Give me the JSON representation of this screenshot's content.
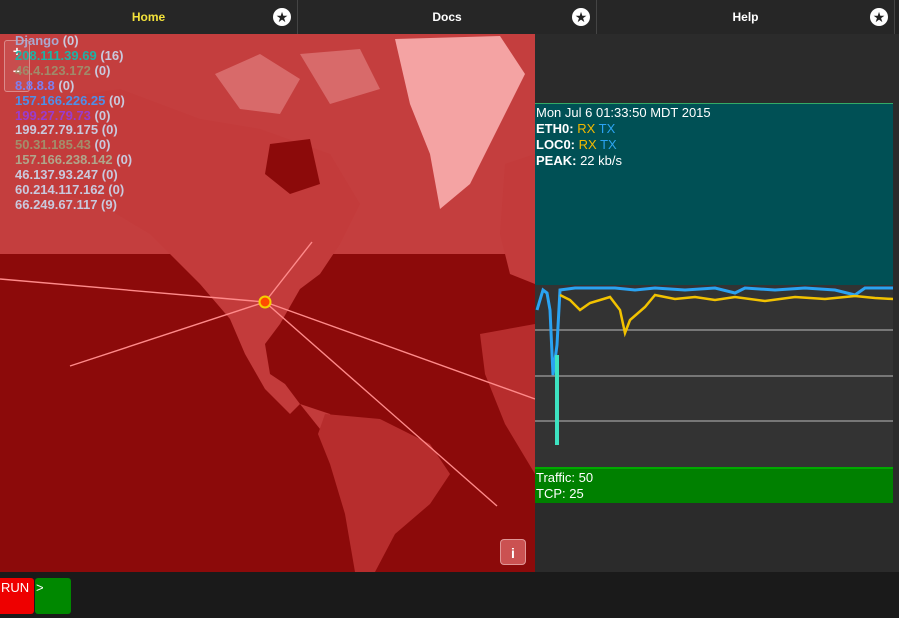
{
  "tabs": [
    {
      "label": "Home",
      "active": true,
      "icon": "star-icon"
    },
    {
      "label": "Docs",
      "active": false,
      "icon": "star-icon"
    },
    {
      "label": "Help",
      "active": false,
      "icon": "star-icon"
    }
  ],
  "map": {
    "zoom_in": "+",
    "zoom_out": "−",
    "info_button": "i",
    "hosts": [
      {
        "name": "Django",
        "count": "(0)",
        "color": "#a9a9cf"
      },
      {
        "name": "208.111.39.69",
        "count": "(16)",
        "color": "#1eb3a6"
      },
      {
        "name": "46.4.123.172",
        "count": "(0)",
        "color": "#a08a6a"
      },
      {
        "name": "8.8.8.8",
        "count": "(0)",
        "color": "#7e7ef0"
      },
      {
        "name": "157.166.226.25",
        "count": "(0)",
        "color": "#4f8fe8"
      },
      {
        "name": "199.27.79.73",
        "count": "(0)",
        "color": "#9a3ccf"
      },
      {
        "name": "199.27.79.175",
        "count": "(0)",
        "color": "#c9c9dd"
      },
      {
        "name": "50.31.185.43",
        "count": "(0)",
        "color": "#a38d6b"
      },
      {
        "name": "157.166.238.142",
        "count": "(0)",
        "color": "#b0a58a"
      },
      {
        "name": "46.137.93.247",
        "count": "(0)",
        "color": "#c9c9dd"
      },
      {
        "name": "60.214.117.162",
        "count": "(0)",
        "color": "#c9c9dd"
      },
      {
        "name": "66.249.67.117",
        "count": "(9)",
        "color": "#c9c9dd"
      }
    ]
  },
  "netstat": {
    "timestamp": "Mon Jul 6 01:33:50 MDT 2015",
    "eth0_label": "ETH0:",
    "loc0_label": "LOC0:",
    "rx": "RX",
    "tx": "TX",
    "peak_label": "PEAK:",
    "peak_value": "22 kb/s"
  },
  "traffic": {
    "traffic_label": "Traffic: 50",
    "tcp_label": "TCP: 25"
  },
  "bottom": {
    "run_label": "RUN",
    "prompt_label": ">"
  },
  "colors": {
    "active_tab": "#f3e23b",
    "rx": "#f2b800",
    "tx": "#2aa3f2",
    "map_overlay": "#8e0b0b",
    "net_panel": "#005055",
    "traffic_panel": "#008000",
    "run_button": "#e00000",
    "prompt_button": "#008800"
  }
}
